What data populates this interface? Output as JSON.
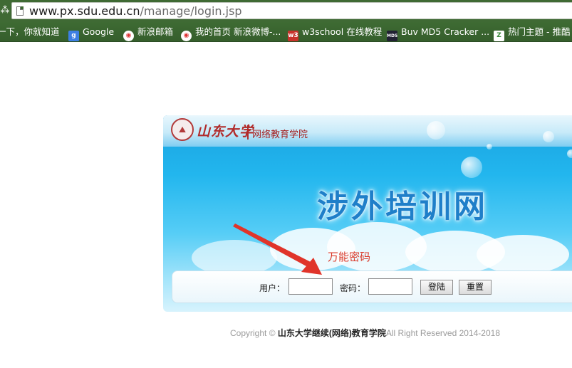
{
  "browser": {
    "url_host": "www.px.sdu.edu.cn",
    "url_path": "/manage/login.jsp",
    "bookmarks": [
      {
        "label": "一下，你就知道",
        "icon": "none"
      },
      {
        "label": "Google",
        "icon": "google-icon"
      },
      {
        "label": "新浪邮箱",
        "icon": "weibo-icon"
      },
      {
        "label": "我的首页 新浪微博-...",
        "icon": "weibo-icon"
      },
      {
        "label": "w3school 在线教程",
        "icon": "w3school-icon"
      },
      {
        "label": "Buv MD5 Cracker ...",
        "icon": "md5-icon"
      },
      {
        "label": "热门主题 - 推酷",
        "icon": "tuicool-icon"
      }
    ],
    "colors": {
      "chrome": "#3f6a34"
    }
  },
  "banner": {
    "logo_script": "山东大学",
    "logo_sub": "网络教育学院",
    "title": "涉外培训网",
    "colors": {
      "sky": "#22b6ee",
      "title": "#1f7fc9"
    }
  },
  "login": {
    "user_label": "用户：",
    "password_label": "密码：",
    "login_button": "登陆",
    "reset_button": "重置",
    "user_value": "",
    "password_value": ""
  },
  "annotation": {
    "text": "万能密码",
    "color": "#d93a2b"
  },
  "footer": {
    "copyright": "Copyright ©",
    "org": "山东大学继续(网络)教育学院",
    "rights": "All Right Reserved 2014-2018"
  }
}
